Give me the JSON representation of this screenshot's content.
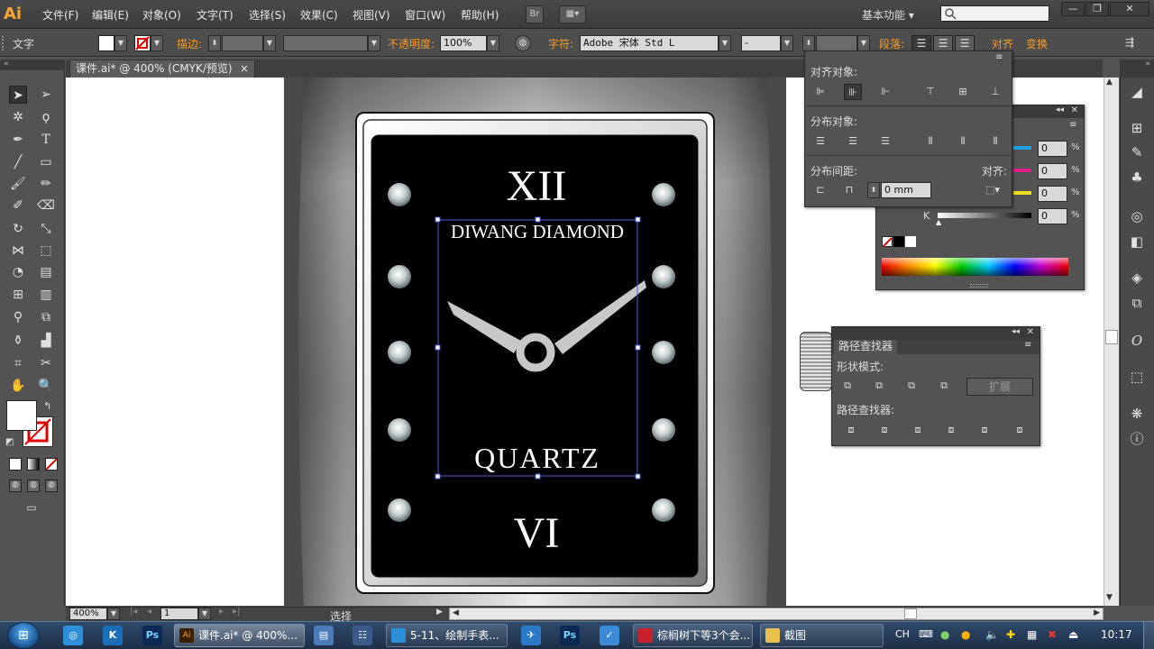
{
  "app": {
    "logo": "Ai"
  },
  "menu": [
    "文件(F)",
    "编辑(E)",
    "对象(O)",
    "文字(T)",
    "选择(S)",
    "效果(C)",
    "视图(V)",
    "窗口(W)",
    "帮助(H)"
  ],
  "menubar": {
    "bridge_label": "Br",
    "workspace": "基本功能"
  },
  "control_bar": {
    "mode_label": "文字",
    "stroke_label": "描边:",
    "opacity_label": "不透明度:",
    "opacity_value": "100%",
    "char_label": "字符:",
    "font_value": "Adobe 宋体 Std L",
    "style_value": "-",
    "para_label": "段落:",
    "align_label": "对齐",
    "transform_label": "变换"
  },
  "document": {
    "tab_title": "课件.ai* @ 400% (CMYK/预览)",
    "close": "×"
  },
  "artwork": {
    "brand": "DIWANG DIAMOND",
    "model": "QUARTZ",
    "numeral_top": "XII",
    "numeral_bottom": "VI"
  },
  "align_panel": {
    "align_objects": "对齐对象:",
    "distribute_objects": "分布对象:",
    "distribute_spacing": "分布间距:",
    "align_to": "对齐:",
    "spacing_value": "0 mm"
  },
  "color_panel": {
    "k_label": "K",
    "values": [
      "0",
      "0",
      "0",
      "0"
    ],
    "unit": "%"
  },
  "pathfinder_panel": {
    "title": "路径查找器",
    "shape_modes": "形状模式:",
    "expand": "扩展",
    "pathfinders": "路径查找器:"
  },
  "status_bar": {
    "zoom": "400%",
    "page": "1",
    "tool": "选择"
  },
  "taskbar": {
    "items": [
      "课件.ai* @ 400%...",
      "5-11、绘制手表...",
      "棕榈树下等3个会...",
      "截图"
    ],
    "lang": "CH",
    "time": "10:17"
  }
}
